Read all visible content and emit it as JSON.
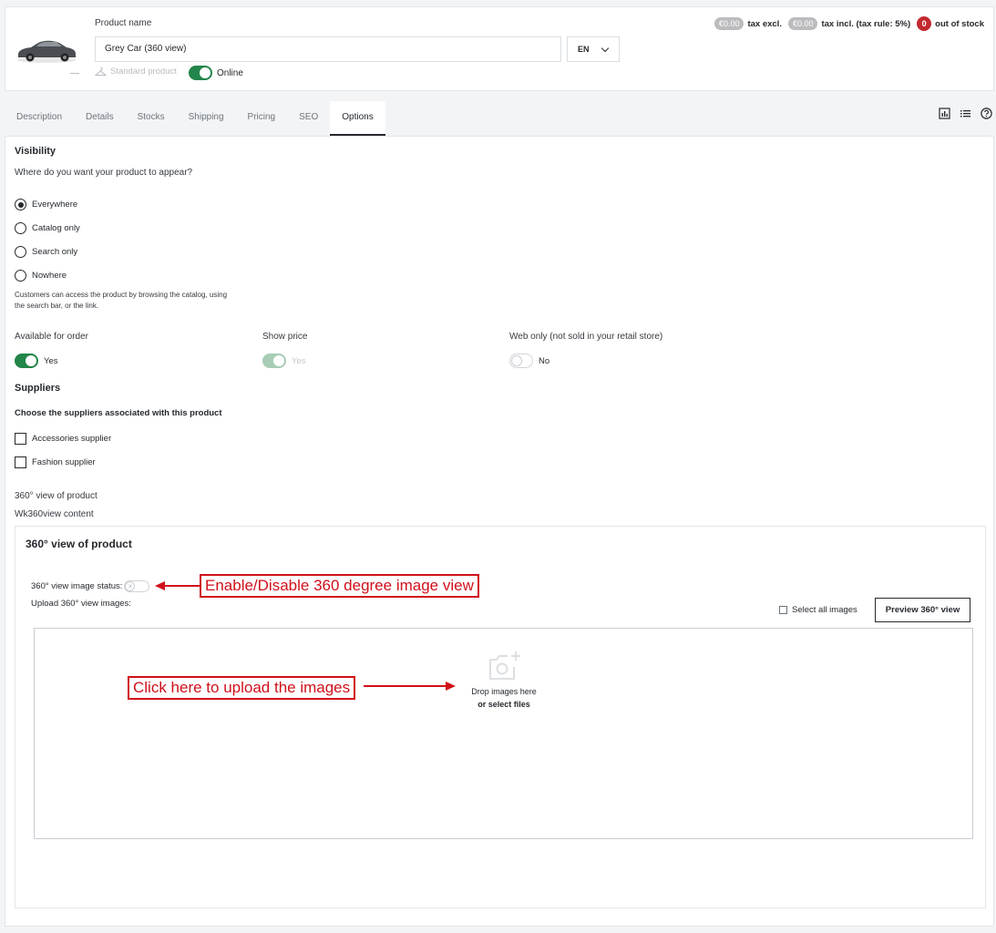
{
  "header": {
    "product_name_label": "Product name",
    "product_name_value": "Grey Car (360 view)",
    "language": "EN",
    "product_type": "Standard product",
    "online_label": "Online",
    "online_enabled": true,
    "price_excl": "€0.00",
    "price_excl_label": "tax excl.",
    "price_incl": "€0.00",
    "price_incl_label": "tax incl. (tax rule: 5%)",
    "stock_count": "0",
    "stock_label": "out of stock"
  },
  "tabs": [
    {
      "label": "Description",
      "active": false
    },
    {
      "label": "Details",
      "active": false
    },
    {
      "label": "Stocks",
      "active": false
    },
    {
      "label": "Shipping",
      "active": false
    },
    {
      "label": "Pricing",
      "active": false
    },
    {
      "label": "SEO",
      "active": false
    },
    {
      "label": "Options",
      "active": true
    }
  ],
  "toolbar_icons": [
    "stats-icon",
    "list-icon",
    "help-icon"
  ],
  "visibility": {
    "title": "Visibility",
    "question": "Where do you want your product to appear?",
    "options": [
      {
        "label": "Everywhere",
        "checked": true
      },
      {
        "label": "Catalog only",
        "checked": false
      },
      {
        "label": "Search only",
        "checked": false
      },
      {
        "label": "Nowhere",
        "checked": false
      }
    ],
    "help_text": "Customers can access the product by browsing the catalog, using the search bar, or the link."
  },
  "order_options": {
    "available_label": "Available for order",
    "available_value": "Yes",
    "show_price_label": "Show price",
    "show_price_value": "Yes",
    "web_only_label": "Web only (not sold in your retail store)",
    "web_only_value": "No"
  },
  "suppliers": {
    "title": "Suppliers",
    "subtitle": "Choose the suppliers associated with this product",
    "items": [
      {
        "label": "Accessories supplier",
        "checked": false
      },
      {
        "label": "Fashion supplier",
        "checked": false
      }
    ]
  },
  "view360": {
    "section_label": "360° view of product",
    "content_label": "Wk360view content",
    "card_title": "360° view of product",
    "status_label": "360° view image status:",
    "upload_label": "Upload 360° view images:",
    "select_all": "Select all images",
    "preview_button": "Preview 360° view",
    "drop_text": "Drop images here",
    "select_files": "or select files"
  },
  "annotations": {
    "enable_disable": "Enable/Disable 360 degree image view",
    "click_upload": "Click here to upload the images",
    "color": "#d0101a"
  },
  "colors": {
    "accent_green": "#228549",
    "danger_red": "#c2292e",
    "text_dark": "#25292e"
  }
}
